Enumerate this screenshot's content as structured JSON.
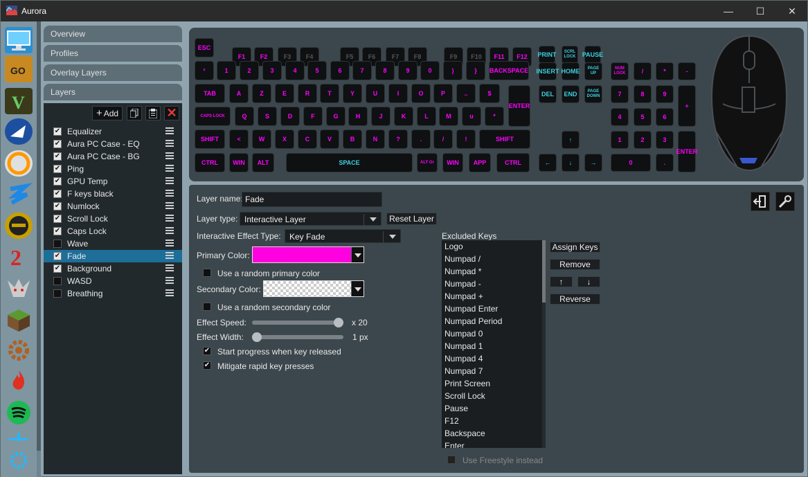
{
  "window": {
    "title": "Aurora",
    "minimize": "—",
    "maximize": "☐",
    "close": "✕"
  },
  "apps": [
    "desktop-icon",
    "csgo-icon",
    "gta5-icon",
    "rocket-league-icon",
    "overwatch-icon",
    "payday2-icon",
    "dishonored2-icon",
    "guild-wars2-icon",
    "witcher3-icon",
    "minecraft-icon",
    "settings-gear-icon",
    "fire-icon",
    "spotify-icon",
    "add-app-icon"
  ],
  "sidebar": {
    "overview": "Overview",
    "profiles": "Profiles",
    "overlay_layers": "Overlay Layers",
    "layers": "Layers",
    "add_label": "Add",
    "layers_list": [
      {
        "name": "Equalizer",
        "checked": true
      },
      {
        "name": "Aura PC Case - EQ",
        "checked": true
      },
      {
        "name": "Aura PC Case - BG",
        "checked": true
      },
      {
        "name": "Ping",
        "checked": true
      },
      {
        "name": "GPU Temp",
        "checked": true
      },
      {
        "name": "F keys black",
        "checked": true
      },
      {
        "name": "Numlock",
        "checked": true
      },
      {
        "name": "Scroll Lock",
        "checked": true
      },
      {
        "name": "Caps Lock",
        "checked": true
      },
      {
        "name": "Wave",
        "checked": false
      },
      {
        "name": "Fade",
        "checked": true,
        "selected": true
      },
      {
        "name": "Background",
        "checked": true
      },
      {
        "name": "WASD",
        "checked": false
      },
      {
        "name": "Breathing",
        "checked": false
      }
    ]
  },
  "keyboard": {
    "row1": [
      "ESC",
      "F1",
      "F2",
      "F3",
      "F4",
      "F5",
      "F6",
      "F7",
      "F8",
      "F9",
      "F10",
      "F11",
      "F12",
      "PRINT",
      "SCRL LOCK",
      "PAUSE"
    ],
    "row2": [
      "²",
      "1",
      "2",
      "3",
      "4",
      "5",
      "6",
      "7",
      "8",
      "9",
      "0",
      ")",
      "}",
      "BACKSPACE",
      "INSERT",
      "HOME",
      "PAGE UP",
      "NUM LOCK",
      "/",
      "*",
      "-"
    ],
    "row3": [
      "TAB",
      "A",
      "Z",
      "E",
      "R",
      "T",
      "Y",
      "U",
      "I",
      "O",
      "P",
      "..",
      "$",
      "ENTER",
      "DEL",
      "END",
      "PAGE DOWN",
      "7",
      "8",
      "9",
      "+"
    ],
    "row4": [
      "CAPS LOCK",
      "Q",
      "S",
      "D",
      "F",
      "G",
      "H",
      "J",
      "K",
      "L",
      "M",
      "u",
      "*",
      "4",
      "5",
      "6"
    ],
    "row5": [
      "SHIFT",
      "<",
      "W",
      "X",
      "C",
      "V",
      "B",
      "N",
      "?",
      ".",
      "/",
      "!",
      "SHIFT",
      "↑",
      "1",
      "2",
      "3",
      "ENTER"
    ],
    "row6": [
      "CTRL",
      "WIN",
      "ALT",
      "SPACE",
      "ALT Gr",
      "WIN",
      "APP",
      "CTRL",
      "←",
      "↓",
      "→",
      "0",
      "."
    ]
  },
  "settings": {
    "layer_name_label": "Layer name:",
    "layer_name_value": "Fade",
    "layer_type_label": "Layer type:",
    "layer_type_value": "Interactive Layer",
    "reset_layer": "Reset Layer",
    "effect_type_label": "Interactive Effect Type:",
    "effect_type_value": "Key Fade",
    "primary_color_label": "Primary Color:",
    "primary_color": "#ff00e1",
    "random_primary_label": "Use a random primary color",
    "random_primary": false,
    "secondary_color_label": "Secondary Color:",
    "random_secondary_label": "Use a random secondary color",
    "random_secondary": false,
    "effect_speed_label": "Effect Speed:",
    "effect_speed_value": "x 20",
    "effect_speed_level": 1.0,
    "effect_width_label": "Effect Width:",
    "effect_width_value": "1 px",
    "effect_width_level": 0.0,
    "start_progress_label": "Start progress when key released",
    "start_progress": true,
    "mitigate_label": "Mitigate rapid key presses",
    "mitigate": true,
    "excluded_keys_label": "Excluded Keys",
    "excluded_keys": [
      "Logo",
      "Numpad /",
      "Numpad *",
      "Numpad -",
      "Numpad +",
      "Numpad Enter",
      "Numpad Period",
      "Numpad 0",
      "Numpad 1",
      "Numpad 4",
      "Numpad 7",
      "Print Screen",
      "Scroll Lock",
      "Pause",
      "F12",
      "Backspace",
      "Enter"
    ],
    "assign_keys": "Assign Keys",
    "remove": "Remove",
    "move_up": "↑",
    "move_down": "↓",
    "reverse": "Reverse",
    "use_freestyle_label": "Use Freestyle instead"
  }
}
